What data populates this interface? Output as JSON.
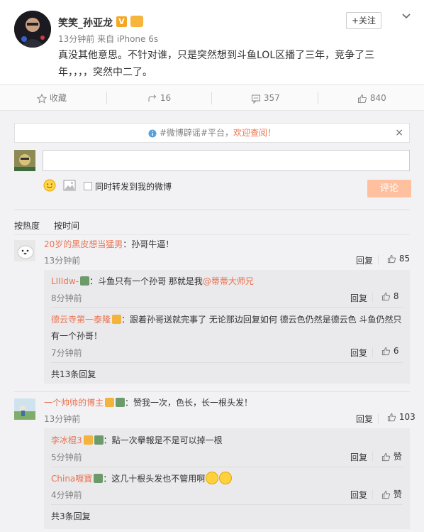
{
  "post": {
    "username": "笑笑_孙亚龙",
    "v_badge": "V",
    "follow_label": "+关注",
    "meta": "13分钟前 来自 iPhone 6s",
    "text": "真没其他意思。不针对谁，只是突然想到斗鱼LOL区播了三年，竞争了三年，，，，突然中二了。"
  },
  "actions": {
    "collect": "收藏",
    "forward_count": "16",
    "comment_count": "357",
    "like_count": "840"
  },
  "notice": {
    "prefix": "#微博辟谣#平台，",
    "highlight": "欢迎查阅！",
    "close": "×"
  },
  "composer": {
    "placeholder": "",
    "forward_label": "同时转发到我的微博",
    "submit_label": "评论"
  },
  "sort": {
    "hot": "按热度",
    "time": "按时间"
  },
  "comments": [
    {
      "user": "20岁的黑皮想当猛男",
      "text": "：孙哥牛逼！",
      "time": "13分钟前",
      "reply": "回复",
      "likes": "85",
      "replies": [
        {
          "user": "LIIIdw-",
          "text": "：斗鱼只有一个孙哥 那就是我",
          "mention": "@蒂蒂大师兄",
          "time": "8分钟前",
          "reply": "回复",
          "likes": "8"
        },
        {
          "user": "德云寺第一泰隆",
          "text1": "：跟着孙哥送就完事了 无论那边回复如何 德云色仍然是德云色 斗鱼仍然只",
          "text2": "有一个孙哥！",
          "time": "7分钟前",
          "reply": "回复",
          "likes": "6"
        }
      ],
      "more": "共13条回复"
    },
    {
      "user": "一个帅帅的博主",
      "text": "：赞我一次，色长，长一根头发！",
      "time": "13分钟前",
      "reply": "回复",
      "likes": "103",
      "replies": [
        {
          "user": "李冰棍3",
          "text": "：點一次擧報是不是可以掉一根",
          "time": "5分钟前",
          "reply": "回复",
          "likes": "赞"
        },
        {
          "user": "China喱寶",
          "text": "：这几十根头发也不管用啊",
          "time": "4分钟前",
          "reply": "回复",
          "likes": "赞"
        }
      ],
      "more": "共3条回复"
    }
  ]
}
